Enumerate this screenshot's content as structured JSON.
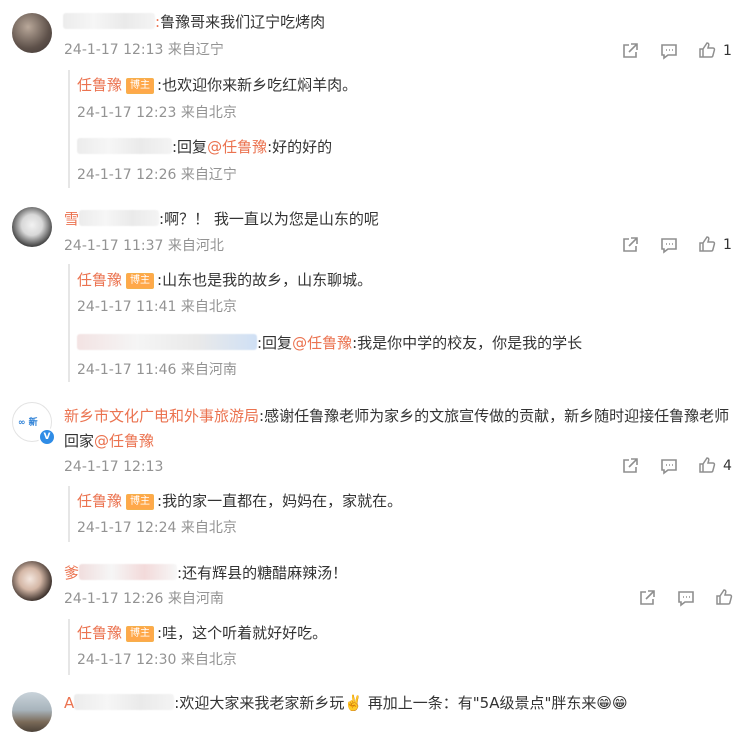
{
  "comments": [
    {
      "user_suffix": ":",
      "text": "鲁豫哥来我们辽宁吃烤肉",
      "time": "24-1-17 12:13 来自辽宁",
      "likes": "1",
      "replies": [
        {
          "name": "任鲁豫",
          "badge": "博主",
          "text": ":也欢迎你来新乡吃红焖羊肉。",
          "time": "24-1-17 12:23 来自北京"
        },
        {
          "prefix": ":回复",
          "mention": "@任鲁豫",
          "text": ":好的好的",
          "time": "24-1-17 12:26 来自辽宁"
        }
      ]
    },
    {
      "user_prefix": "雪",
      "text": ":啊？！ 我一直以为您是山东的呢",
      "time": "24-1-17 11:37 来自河北",
      "likes": "1",
      "replies": [
        {
          "name": "任鲁豫",
          "badge": "博主",
          "text": ":山东也是我的故乡，山东聊城。",
          "time": "24-1-17 11:41 来自北京"
        },
        {
          "prefix": ":回复",
          "mention": "@任鲁豫",
          "text": ":我是你中学的校友，你是我的学长",
          "time": "24-1-17 11:46 来自河南"
        }
      ]
    },
    {
      "user": "新乡市文化广电和外事旅游局",
      "text": ":感谢任鲁豫老师为家乡的文旅宣传做的贡献，新乡随时迎接任鲁豫老师回家",
      "mention": "@任鲁豫",
      "time": "24-1-17 12:13",
      "likes": "4",
      "verified_mark": "V",
      "replies": [
        {
          "name": "任鲁豫",
          "badge": "博主",
          "text": ":我的家一直都在，妈妈在，家就在。",
          "time": "24-1-17 12:24 来自北京"
        }
      ]
    },
    {
      "user_prefix": "爹",
      "text": ":还有辉县的糖醋麻辣汤！",
      "time": "24-1-17 12:26 来自河南",
      "replies": [
        {
          "name": "任鲁豫",
          "badge": "博主",
          "text": ":哇，这个听着就好好吃。",
          "time": "24-1-17 12:30 来自北京"
        }
      ]
    },
    {
      "user_prefix": "A",
      "text": ":欢迎大家来我老家新乡玩✌️ 再加上一条：有\"5A级景点\"胖东来😁😁"
    }
  ]
}
